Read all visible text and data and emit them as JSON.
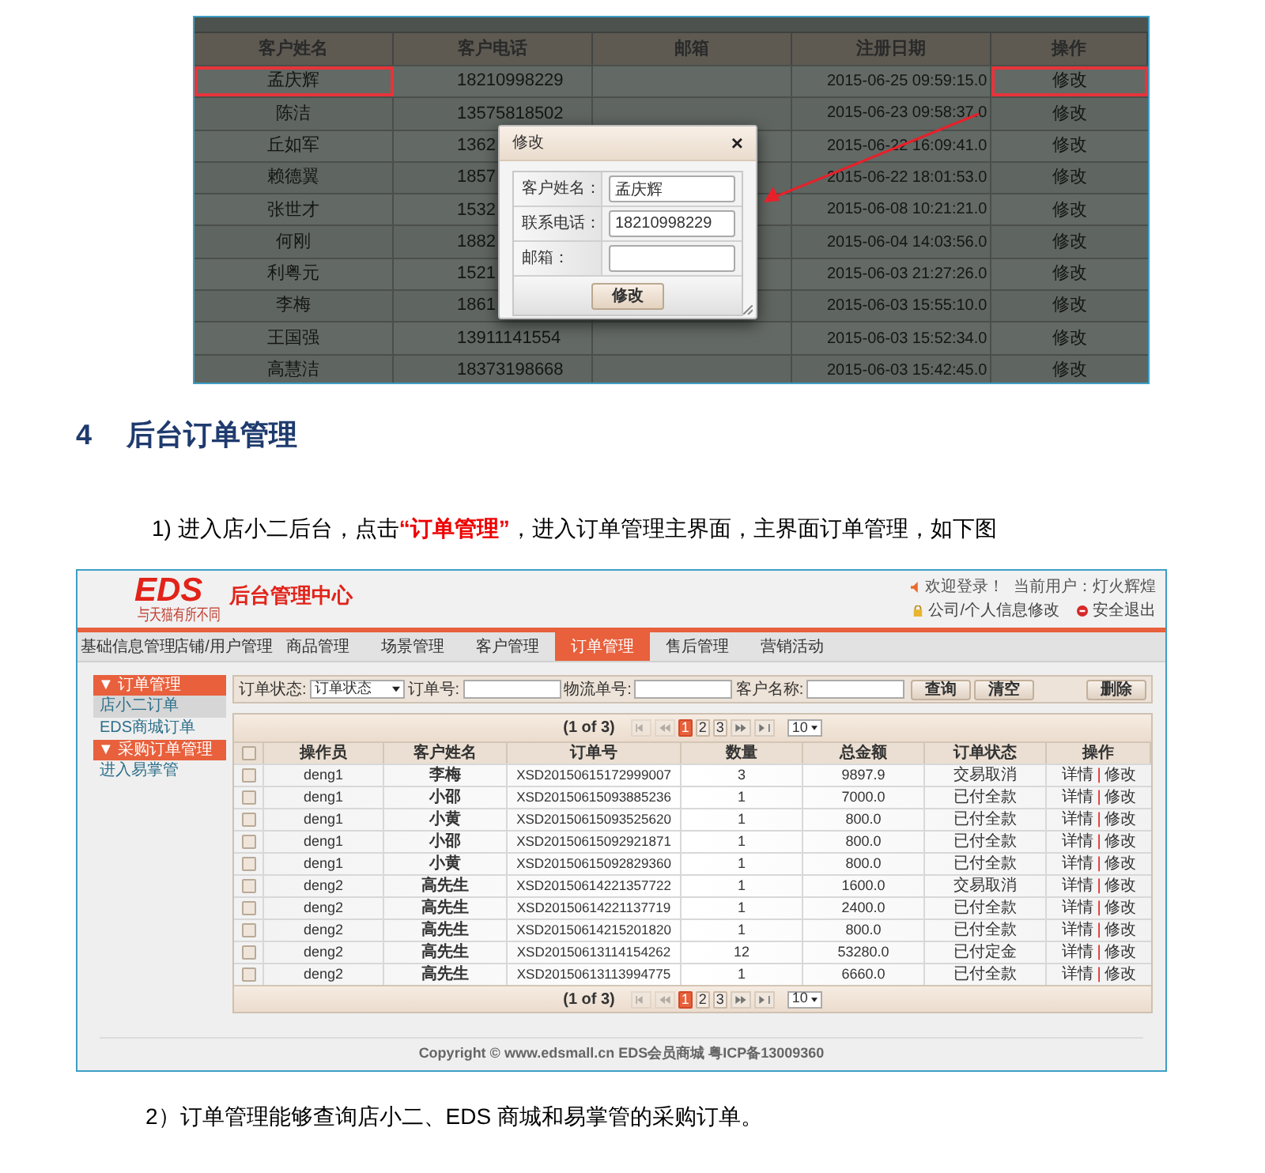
{
  "customer_screenshot": {
    "columns": [
      "客户姓名",
      "客户电话",
      "邮箱",
      "注册日期",
      "操作"
    ],
    "rows": [
      {
        "name": "孟庆辉",
        "phone": "18210998229",
        "registered": "2015-06-25 09:59:15.0",
        "action": "修改",
        "highlighted": true
      },
      {
        "name": "陈洁",
        "phone": "13575818502",
        "registered": "2015-06-23 09:58:37.0",
        "action": "修改",
        "highlighted": false
      },
      {
        "name": "丘如军",
        "phone": "1362",
        "registered": "2015-06-22 16:09:41.0",
        "action": "修改",
        "highlighted": false
      },
      {
        "name": "赖德翼",
        "phone": "1857",
        "registered": "2015-06-22 18:01:53.0",
        "action": "修改",
        "highlighted": false
      },
      {
        "name": "张世才",
        "phone": "1532",
        "registered": "2015-06-08 10:21:21.0",
        "action": "修改",
        "highlighted": false
      },
      {
        "name": "何刚",
        "phone": "1882",
        "registered": "2015-06-04 14:03:56.0",
        "action": "修改",
        "highlighted": false
      },
      {
        "name": "利粤元",
        "phone": "1521",
        "registered": "2015-06-03 21:27:26.0",
        "action": "修改",
        "highlighted": false
      },
      {
        "name": "李梅",
        "phone": "1861",
        "registered": "2015-06-03 15:55:10.0",
        "action": "修改",
        "highlighted": false
      },
      {
        "name": "王国强",
        "phone": "13911141554",
        "registered": "2015-06-03 15:52:34.0",
        "action": "修改",
        "highlighted": false
      },
      {
        "name": "高慧洁",
        "phone": "18373198668",
        "registered": "2015-06-03 15:42:45.0",
        "action": "修改",
        "highlighted": false
      }
    ],
    "modal": {
      "title": "修改",
      "close": "×",
      "fields": [
        {
          "label": "客户姓名：",
          "value": "孟庆辉"
        },
        {
          "label": "联系电话：",
          "value": "18210998229"
        },
        {
          "label": "邮箱："
        }
      ],
      "button": "修改"
    }
  },
  "section": {
    "number": "4",
    "title": "后台订单管理"
  },
  "step_1": "1)  进入店小二后台，点击**“订单管理”**，进入订单管理主界面，主界面订单管理，如下图",
  "admin_screenshot": {
    "header": {
      "logo": "EDS",
      "tagline": "与天猫有所不同",
      "title": "后台管理中心",
      "welcome": "欢迎登录！",
      "current_user": "当前用户：灯火辉煌",
      "profile_link": "公司/个人信息修改",
      "logout": "安全退出"
    },
    "nav": [
      {
        "label": "基础信息管理",
        "selected": false
      },
      {
        "label": "店铺/用户管理",
        "selected": false
      },
      {
        "label": "商品管理",
        "selected": false
      },
      {
        "label": "场景管理",
        "selected": false
      },
      {
        "label": "客户管理",
        "selected": false
      },
      {
        "label": "订单管理",
        "selected": true
      },
      {
        "label": "售后管理",
        "selected": false
      },
      {
        "label": "营销活动",
        "selected": false
      }
    ],
    "sidebar": [
      {
        "kind": "header",
        "label": "▼ 订单管理"
      },
      {
        "kind": "item",
        "label": "店小二订单",
        "selected": true
      },
      {
        "kind": "item",
        "label": "EDS商城订单",
        "selected": false
      },
      {
        "kind": "header",
        "label": "▼ 采购订单管理"
      },
      {
        "kind": "item",
        "label": "进入易掌管",
        "selected": false
      }
    ],
    "filters": {
      "status_label": "订单状态:",
      "status_value": "订单状态",
      "order_label": "订单号:",
      "tracking_label": "物流单号:",
      "customer_label": "客户名称:",
      "search": "查询",
      "clear": "清空",
      "delete": "删除"
    },
    "pager": {
      "summary": "(1 of 3)",
      "pages": [
        {
          "label": "1",
          "selected": true
        },
        {
          "label": "2",
          "selected": false
        },
        {
          "label": "3",
          "selected": false
        }
      ],
      "page_size": "10"
    },
    "header_checked": false,
    "columns": [
      "操作员",
      "客户姓名",
      "订单号",
      "数量",
      "总金额",
      "订单状态",
      "操作"
    ],
    "rows": [
      {
        "checked": false,
        "operator": "deng1",
        "customer": "李梅",
        "order_no": "XSD20150615172999007",
        "qty": "3",
        "total": "9897.9",
        "status": "交易取消",
        "detail": "详情",
        "sep": "|",
        "edit": "修改"
      },
      {
        "checked": false,
        "operator": "deng1",
        "customer": "小邵",
        "order_no": "XSD20150615093885236",
        "qty": "1",
        "total": "7000.0",
        "status": "已付全款",
        "detail": "详情",
        "sep": "|",
        "edit": "修改"
      },
      {
        "checked": false,
        "operator": "deng1",
        "customer": "小黄",
        "order_no": "XSD20150615093525620",
        "qty": "1",
        "total": "800.0",
        "status": "已付全款",
        "detail": "详情",
        "sep": "|",
        "edit": "修改"
      },
      {
        "checked": false,
        "operator": "deng1",
        "customer": "小邵",
        "order_no": "XSD20150615092921871",
        "qty": "1",
        "total": "800.0",
        "status": "已付全款",
        "detail": "详情",
        "sep": "|",
        "edit": "修改"
      },
      {
        "checked": false,
        "operator": "deng1",
        "customer": "小黄",
        "order_no": "XSD20150615092829360",
        "qty": "1",
        "total": "800.0",
        "status": "已付全款",
        "detail": "详情",
        "sep": "|",
        "edit": "修改"
      },
      {
        "checked": false,
        "operator": "deng2",
        "customer": "高先生",
        "order_no": "XSD20150614221357722",
        "qty": "1",
        "total": "1600.0",
        "status": "交易取消",
        "detail": "详情",
        "sep": "|",
        "edit": "修改"
      },
      {
        "checked": false,
        "operator": "deng2",
        "customer": "高先生",
        "order_no": "XSD20150614221137719",
        "qty": "1",
        "total": "2400.0",
        "status": "已付全款",
        "detail": "详情",
        "sep": "|",
        "edit": "修改"
      },
      {
        "checked": false,
        "operator": "deng2",
        "customer": "高先生",
        "order_no": "XSD20150614215201820",
        "qty": "1",
        "total": "800.0",
        "status": "已付全款",
        "detail": "详情",
        "sep": "|",
        "edit": "修改"
      },
      {
        "checked": false,
        "operator": "deng2",
        "customer": "高先生",
        "order_no": "XSD20150613114154262",
        "qty": "12",
        "total": "53280.0",
        "status": "已付定金",
        "detail": "详情",
        "sep": "|",
        "edit": "修改"
      },
      {
        "checked": false,
        "operator": "deng2",
        "customer": "高先生",
        "order_no": "XSD20150613113994775",
        "qty": "1",
        "total": "6660.0",
        "status": "已付全款",
        "detail": "详情",
        "sep": "|",
        "edit": "修改"
      }
    ],
    "pager_bottom": {
      "summary": "(1 of 3)",
      "pages": [
        {
          "label": "1",
          "selected": true
        },
        {
          "label": "2",
          "selected": false
        },
        {
          "label": "3",
          "selected": false
        }
      ],
      "page_size": "10"
    },
    "footer": "Copyright © www.edsmall.cn EDS会员商城 粤ICP备13009360"
  },
  "step_2": "2）订单管理能够查询店小二、EDS 商城和易掌管的采购订单。"
}
